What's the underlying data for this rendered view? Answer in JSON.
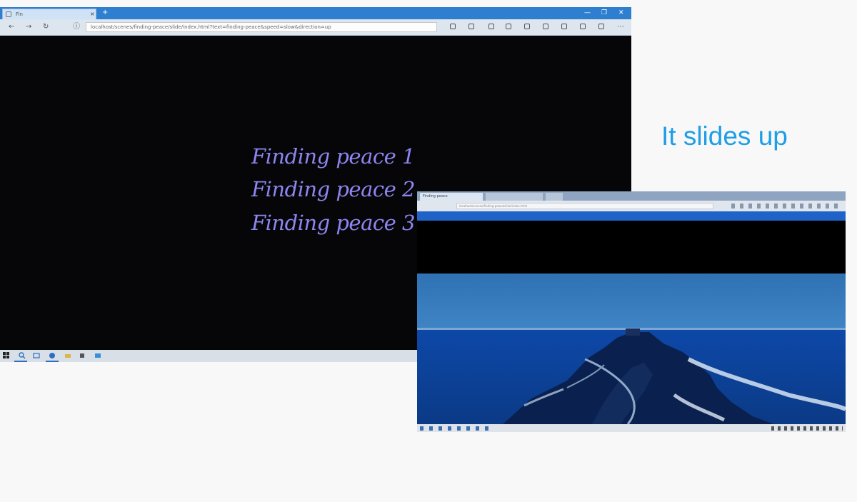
{
  "caption": "It slides up",
  "large_window": {
    "tab_title": "Fin",
    "new_tab": "+",
    "window_controls": [
      "—",
      "❐",
      "✕"
    ],
    "url": "localhost/scenes/finding-peace/slide/index.html?text=finding-peace&speed=slow&direction=up",
    "lines": [
      "Finding peace 1",
      "Finding peace 2",
      "Finding peace 3"
    ]
  },
  "small_window": {
    "tab_title": "Finding peace",
    "second_tab": "",
    "url": "localhost/scenes/finding-peace/slide/index.html"
  },
  "colors": {
    "text_purple": "#8c86f0",
    "caption_blue": "#1e9ee6",
    "browser_blue": "#2f7fd0"
  }
}
